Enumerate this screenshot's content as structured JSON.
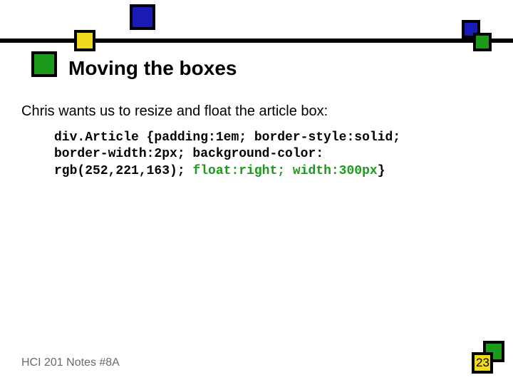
{
  "title": "Moving the boxes",
  "body": "Chris wants us to resize and float the article box:",
  "code": {
    "line1": "div.Article {padding:1em; border-style:solid;",
    "line2": "border-width:2px; background-color:",
    "line3a": "rgb(252,221,163); ",
    "line3b": "float:right; width:300px",
    "line3c": "}"
  },
  "footer": "HCI 201 Notes #8A",
  "page": "23"
}
